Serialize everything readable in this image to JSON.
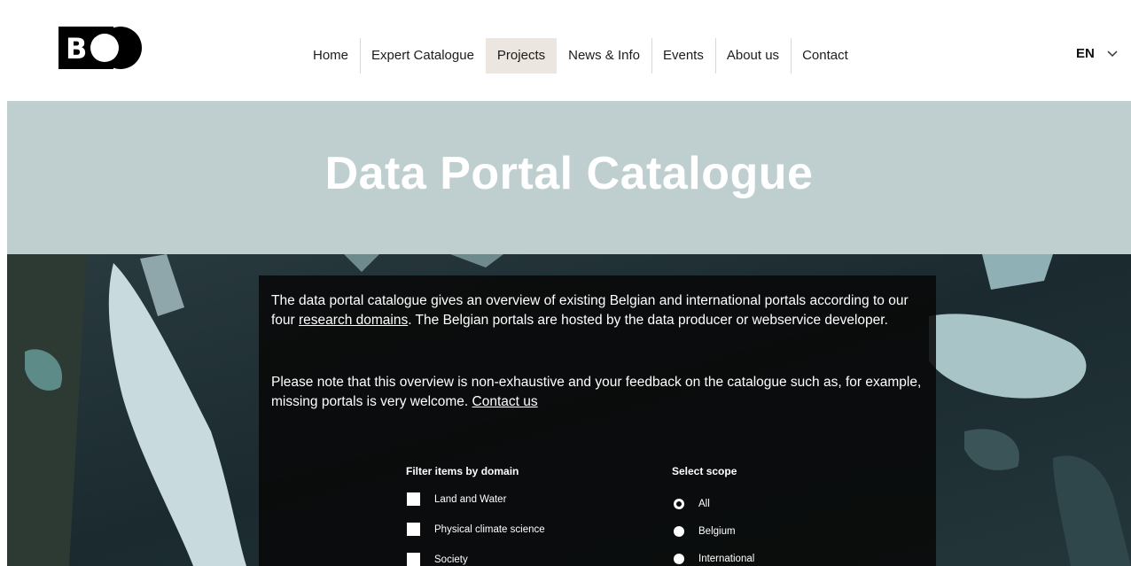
{
  "header": {
    "logo_text": "BC",
    "nav": [
      {
        "label": "Home",
        "active": false
      },
      {
        "label": "Expert Catalogue",
        "active": false
      },
      {
        "label": "Projects",
        "active": true
      },
      {
        "label": "News & Info",
        "active": false
      },
      {
        "label": "Events",
        "active": false
      },
      {
        "label": "About us",
        "active": false
      },
      {
        "label": "Contact",
        "active": false
      }
    ],
    "language": "EN"
  },
  "banner": {
    "title": "Data Portal Catalogue",
    "background_color": "#bfcfd0"
  },
  "info": {
    "p1_before": "The data portal catalogue gives an overview of existing Belgian and international portals according to our four ",
    "p1_link": "research domains",
    "p1_after": ". The Belgian portals are hosted by the data producer or webservice developer.",
    "p2_before": "Please note that this overview is non-exhaustive and your feedback on the catalogue such as, for example, missing portals is very welcome. ",
    "p2_link": "Contact us"
  },
  "filters": {
    "domain_title": "Filter items by domain",
    "domains": [
      {
        "label": "Land and Water",
        "checked": false
      },
      {
        "label": "Physical climate science",
        "checked": false
      },
      {
        "label": "Society",
        "checked": false
      }
    ],
    "scope_title": "Select scope",
    "scopes": [
      {
        "label": "All",
        "selected": true
      },
      {
        "label": "Belgium",
        "selected": false
      },
      {
        "label": "International",
        "selected": false
      }
    ]
  }
}
